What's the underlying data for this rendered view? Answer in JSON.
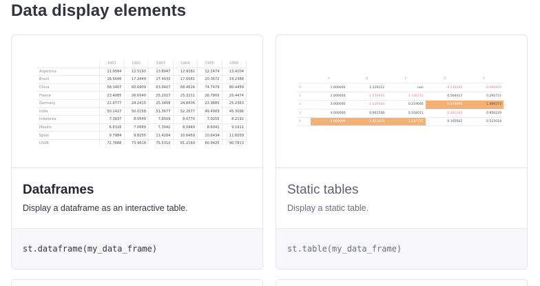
{
  "page": {
    "title": "Data display elements"
  },
  "cards": [
    {
      "title": "Dataframes",
      "description": "Display a dataframe as an interactive table.",
      "code": "st.dataframe(my_data_frame)"
    },
    {
      "title": "Static tables",
      "description": "Display a static table.",
      "code": "st.table(my_data_frame)"
    }
  ],
  "dataframe_preview": {
    "columns": [
      "1961",
      "1962",
      "1963",
      "1964",
      "1965",
      "1966"
    ],
    "rows": [
      {
        "label": "Argentina",
        "values": [
          "11.9584",
          "12.5193",
          "13.6947",
          "12.9182",
          "12.2474",
          "13.4104"
        ]
      },
      {
        "label": "Brazil",
        "values": [
          "16.5646",
          "17.3449",
          "17.4430",
          "17.6581",
          "20.3672",
          "19.2388"
        ]
      },
      {
        "label": "China",
        "values": [
          "58.3407",
          "60.6909",
          "63.9427",
          "68.4626",
          "74.7479",
          "80.4459"
        ]
      },
      {
        "label": "France",
        "values": [
          "23.4085",
          "26.6540",
          "25.2027",
          "25.3211",
          "26.7809",
          "25.4474"
        ]
      },
      {
        "label": "Germany",
        "values": [
          "22.0777",
          "24.2415",
          "25.3408",
          "24.8436",
          "23.9885",
          "25.2363"
        ]
      },
      {
        "label": "India",
        "values": [
          "50.1427",
          "50.0158",
          "51.3677",
          "52.2677",
          "49.4983",
          "45.3096"
        ]
      },
      {
        "label": "Indonesia",
        "values": [
          "7.3837",
          "8.0549",
          "7.6509",
          "8.0770",
          "7.9255",
          "8.2192"
        ]
      },
      {
        "label": "Mexico",
        "values": [
          "6.6326",
          "7.0689",
          "7.3942",
          "8.0449",
          "8.6041",
          "9.1411"
        ]
      },
      {
        "label": "Spain",
        "values": [
          "9.7984",
          "9.8255",
          "11.4204",
          "10.6459",
          "10.6434",
          "11.6059"
        ]
      },
      {
        "label": "USSR",
        "values": [
          "72.7688",
          "73.9619",
          "75.5310",
          "81.2169",
          "80.9420",
          "90.7813"
        ]
      }
    ]
  },
  "static_preview": {
    "columns": [
      "A",
      "B",
      "C",
      "D",
      "E"
    ],
    "rows": [
      {
        "index": "0",
        "values": [
          "1.000000",
          "1.329212",
          "nan",
          "-0.316280",
          "-0.990810"
        ]
      },
      {
        "index": "1",
        "values": [
          "2.000000",
          "-1.070816",
          "-1.438713",
          "0.564417",
          "0.295722"
        ]
      },
      {
        "index": "2",
        "values": [
          "3.000000",
          "-1.626404",
          "0.219565",
          "0.678805",
          "1.889273"
        ]
      },
      {
        "index": "3",
        "values": [
          "4.000000",
          "0.961538",
          "0.104011",
          "-0.481165",
          "0.850229"
        ]
      },
      {
        "index": "4",
        "values": [
          "5.000000",
          "1.453425",
          "1.057737",
          "0.165562",
          "0.515018"
        ]
      }
    ],
    "negative_color": "#f08080",
    "highlight_color": "#f3b174"
  }
}
